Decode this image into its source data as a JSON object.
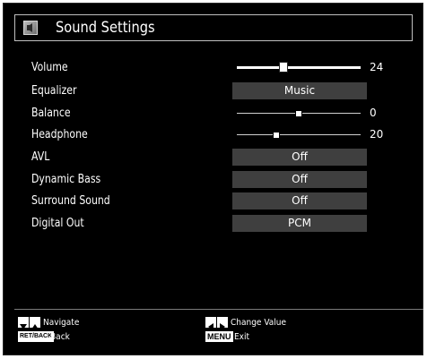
{
  "window": {
    "title": "Sound Settings",
    "title_icon": "sound-settings-icon"
  },
  "settings": [
    {
      "id": "volume",
      "label": "Volume",
      "type": "slider",
      "value": "24",
      "level": 0.38
    },
    {
      "id": "equalizer",
      "label": "Equalizer",
      "type": "select",
      "value": "Music"
    },
    {
      "id": "balance",
      "label": "Balance",
      "type": "slider",
      "value": "0",
      "level": 0.5
    },
    {
      "id": "headphone",
      "label": "Headphone",
      "type": "slider",
      "value": "20",
      "level": 0.32
    },
    {
      "id": "avl",
      "label": "AVL",
      "type": "select",
      "value": "Off"
    },
    {
      "id": "dynamic_bass",
      "label": "Dynamic Bass",
      "type": "select",
      "value": "Off"
    },
    {
      "id": "surround_sound",
      "label": "Surround Sound",
      "type": "select",
      "value": "Off"
    },
    {
      "id": "digital_out",
      "label": "Digital Out",
      "type": "select",
      "value": "PCM"
    }
  ],
  "hints": {
    "navigate": "Navigate",
    "back_key": "RET/BACK",
    "back": "Back",
    "change_value": "Change Value",
    "menu_key": "MENU",
    "exit": "Exit"
  },
  "colors": {
    "background": "#000000",
    "value_box": "#3f3f3f",
    "text": "#ffffff"
  }
}
